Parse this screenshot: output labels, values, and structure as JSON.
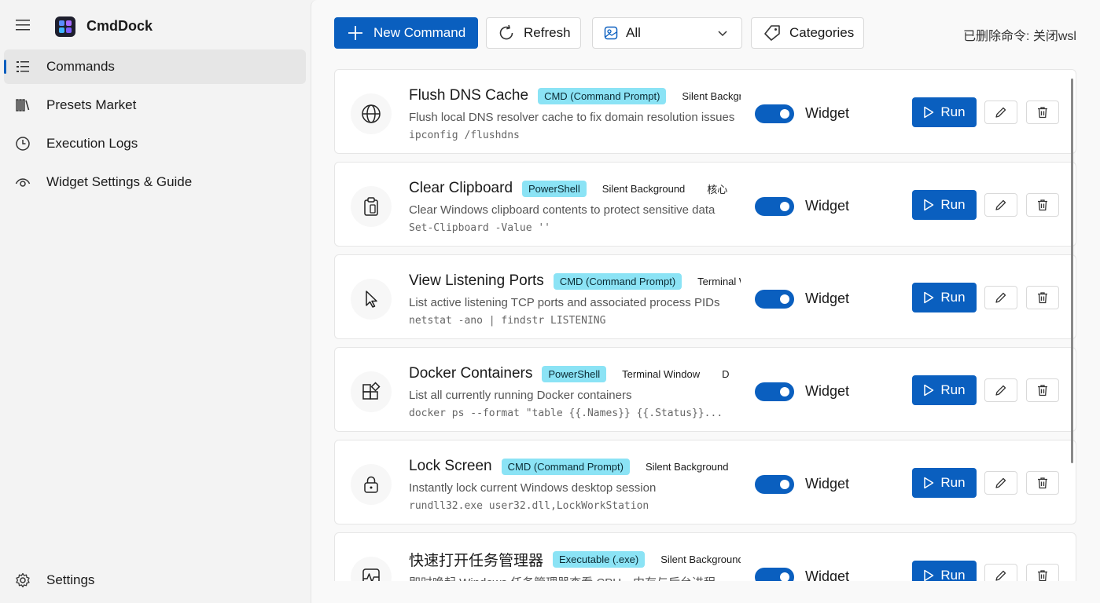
{
  "app": {
    "title": "CmdDock",
    "logo_colors": [
      "#5b8cff",
      "#a56bff",
      "#3fb4ff",
      "#7b5cff"
    ]
  },
  "sidebar": {
    "items": [
      {
        "label": "Commands",
        "icon": "list-icon",
        "active": true
      },
      {
        "label": "Presets Market",
        "icon": "library-icon",
        "active": false
      },
      {
        "label": "Execution Logs",
        "icon": "clock-icon",
        "active": false
      },
      {
        "label": "Widget Settings & Guide",
        "icon": "eye-icon",
        "active": false
      }
    ],
    "footer": {
      "label": "Settings",
      "icon": "gear-icon"
    }
  },
  "toolbar": {
    "new_label": "New Command",
    "refresh_label": "Refresh",
    "filter_value": "All",
    "categories_label": "Categories",
    "status_text": "已删除命令: 关闭wsl"
  },
  "colors": {
    "accent": "#0a5fbf",
    "tag_bg": "#8be3f5"
  },
  "commands": [
    {
      "title": "Flush DNS Cache",
      "type": "CMD (Command Prompt)",
      "mode": "Silent Background",
      "category": "",
      "description": "Flush local DNS resolver cache to fix domain resolution issues",
      "code": "ipconfig /flushdns",
      "icon": "globe-icon",
      "widget_label": "Widget",
      "widget_enabled": true,
      "run_label": "Run"
    },
    {
      "title": "Clear Clipboard",
      "type": "PowerShell",
      "mode": "Silent Background",
      "category": "核心",
      "description": "Clear Windows clipboard contents to protect sensitive data",
      "code": "Set-Clipboard -Value ''",
      "icon": "clipboard-icon",
      "widget_label": "Widget",
      "widget_enabled": true,
      "run_label": "Run"
    },
    {
      "title": "View Listening Ports",
      "type": "CMD (Command Prompt)",
      "mode": "Terminal Window",
      "category": "",
      "description": "List active listening TCP ports and associated process PIDs",
      "code": "netstat -ano | findstr LISTENING",
      "icon": "cursor-icon",
      "widget_label": "Widget",
      "widget_enabled": true,
      "run_label": "Run"
    },
    {
      "title": "Docker Containers",
      "type": "PowerShell",
      "mode": "Terminal Window",
      "category": "D",
      "description": "List all currently running Docker containers",
      "code": "docker ps --format \"table {{.Names}} {{.Status}}...",
      "icon": "apps-icon",
      "widget_label": "Widget",
      "widget_enabled": true,
      "run_label": "Run"
    },
    {
      "title": "Lock Screen",
      "type": "CMD (Command Prompt)",
      "mode": "Silent Background",
      "category": "",
      "description": "Instantly lock current Windows desktop session",
      "code": "rundll32.exe user32.dll,LockWorkStation",
      "icon": "lock-icon",
      "widget_label": "Widget",
      "widget_enabled": true,
      "run_label": "Run"
    },
    {
      "title": "快速打开任务管理器",
      "type": "Executable (.exe)",
      "mode": "Silent Background",
      "category": "",
      "description": "即时唤起 Windows 任务管理器查看 CPU、内存与后台进程",
      "code": "",
      "icon": "pulse-icon",
      "widget_label": "Widget",
      "widget_enabled": true,
      "run_label": "Run"
    }
  ]
}
